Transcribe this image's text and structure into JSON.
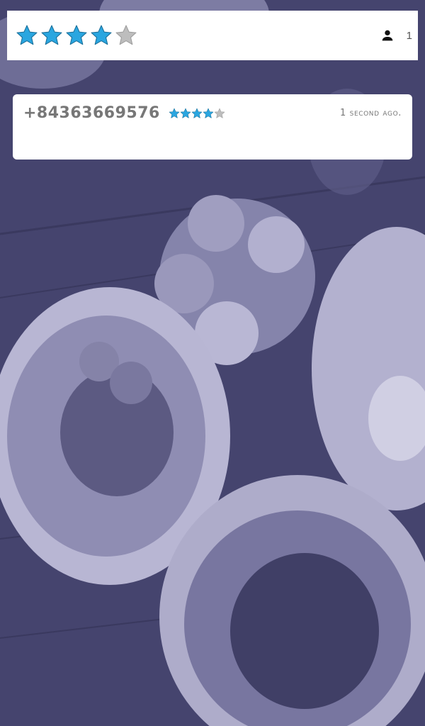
{
  "rating_bar": {
    "rating": 4,
    "max_rating": 5,
    "user_icon": "person-icon",
    "user_count": "1"
  },
  "review": {
    "phone": "+84363669576",
    "rating": 4,
    "max_rating": 5,
    "time_ago": "1 second ago."
  },
  "colors": {
    "star_filled": "#2aa6e0",
    "star_empty": "#bdbdbd",
    "overlay": "#46456f"
  }
}
